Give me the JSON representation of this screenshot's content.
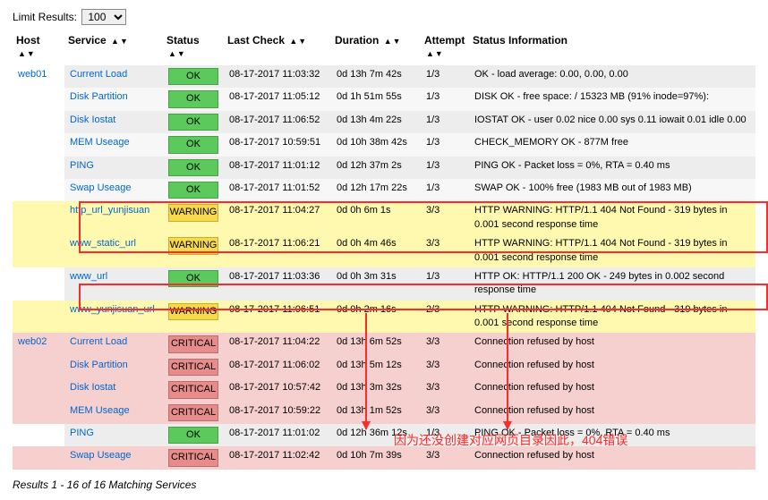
{
  "limit": {
    "label": "Limit Results:",
    "selected": "100"
  },
  "headers": {
    "host": "Host",
    "service": "Service",
    "status": "Status",
    "last_check": "Last Check",
    "duration": "Duration",
    "attempt": "Attempt",
    "info": "Status Information"
  },
  "hosts": {
    "web01": "web01",
    "web02": "web02"
  },
  "rows": [
    {
      "host": "web01",
      "svc": "Current Load",
      "status": "OK",
      "last": "08-17-2017 11:03:32",
      "dur": "0d 13h 7m 42s",
      "att": "1/3",
      "info": "OK - load average: 0.00, 0.00, 0.00",
      "cls": "even",
      "hostshow": true
    },
    {
      "svc": "Disk Partition",
      "status": "OK",
      "last": "08-17-2017 11:05:12",
      "dur": "0d 1h 51m 55s",
      "att": "1/3",
      "info": "DISK OK - free space: / 15323 MB (91% inode=97%):",
      "cls": "odd"
    },
    {
      "svc": "Disk Iostat",
      "status": "OK",
      "last": "08-17-2017 11:06:52",
      "dur": "0d 13h 4m 22s",
      "att": "1/3",
      "info": "IOSTAT OK - user 0.02 nice 0.00 sys 0.11 iowait 0.01 idle 0.00",
      "cls": "even"
    },
    {
      "svc": "MEM Useage",
      "status": "OK",
      "last": "08-17-2017 10:59:51",
      "dur": "0d 10h 38m 42s",
      "att": "1/3",
      "info": "CHECK_MEMORY OK - 877M free",
      "cls": "odd"
    },
    {
      "svc": "PING",
      "status": "OK",
      "last": "08-17-2017 11:01:12",
      "dur": "0d 12h 37m 2s",
      "att": "1/3",
      "info": "PING OK - Packet loss = 0%, RTA = 0.40 ms",
      "cls": "even"
    },
    {
      "svc": "Swap Useage",
      "status": "OK",
      "last": "08-17-2017 11:01:52",
      "dur": "0d 12h 17m 22s",
      "att": "1/3",
      "info": "SWAP OK - 100% free (1983 MB out of 1983 MB)",
      "cls": "odd"
    },
    {
      "svc": "http_url_yunjisuan",
      "status": "WARNING",
      "last": "08-17-2017 11:04:27",
      "dur": "0d 0h 6m 1s",
      "att": "3/3",
      "info": "HTTP WARNING: HTTP/1.1 404 Not Found - 319 bytes in 0.001 second response time",
      "cls": "hl"
    },
    {
      "svc": "www_static_url",
      "status": "WARNING",
      "last": "08-17-2017 11:06:21",
      "dur": "0d 0h 4m 46s",
      "att": "3/3",
      "info": "HTTP WARNING: HTTP/1.1 404 Not Found - 319 bytes in 0.001 second response time",
      "cls": "hl"
    },
    {
      "svc": "www_url",
      "status": "OK",
      "last": "08-17-2017 11:03:36",
      "dur": "0d 0h 3m 31s",
      "att": "1/3",
      "info": "HTTP OK: HTTP/1.1 200 OK - 249 bytes in 0.002 second response time",
      "cls": "even"
    },
    {
      "svc": "www_yunjisuan_url",
      "status": "WARNING",
      "last": "08-17-2017 11:06:51",
      "dur": "0d 0h 2m 16s",
      "att": "2/3",
      "info": "HTTP WARNING: HTTP/1.1 404 Not Found - 319 bytes in 0.001 second response time",
      "cls": "hl"
    },
    {
      "host": "web02",
      "svc": "Current Load",
      "status": "CRITICAL",
      "last": "08-17-2017 11:04:22",
      "dur": "0d 13h 6m 52s",
      "att": "3/3",
      "info": "Connection refused by host",
      "cls": "pink",
      "hostshow": true
    },
    {
      "svc": "Disk Partition",
      "status": "CRITICAL",
      "last": "08-17-2017 11:06:02",
      "dur": "0d 13h 5m 12s",
      "att": "3/3",
      "info": "Connection refused by host",
      "cls": "pink"
    },
    {
      "svc": "Disk Iostat",
      "status": "CRITICAL",
      "last": "08-17-2017 10:57:42",
      "dur": "0d 13h 3m 32s",
      "att": "3/3",
      "info": "Connection refused by host",
      "cls": "pink"
    },
    {
      "svc": "MEM Useage",
      "status": "CRITICAL",
      "last": "08-17-2017 10:59:22",
      "dur": "0d 13h 1m 52s",
      "att": "3/3",
      "info": "Connection refused by host",
      "cls": "pink"
    },
    {
      "svc": "PING",
      "status": "OK",
      "last": "08-17-2017 11:01:02",
      "dur": "0d 12h 36m 12s",
      "att": "1/3",
      "info": "PING OK - Packet loss = 0%, RTA = 0.40 ms",
      "cls": "even"
    },
    {
      "svc": "Swap Useage",
      "status": "CRITICAL",
      "last": "08-17-2017 11:02:42",
      "dur": "0d 10h 7m 39s",
      "att": "3/3",
      "info": "Connection refused by host",
      "cls": "pink"
    }
  ],
  "footer": "Results 1 - 16 of 16 Matching Services",
  "annotation": "因为还没创建对应网页目录因此，404错误"
}
